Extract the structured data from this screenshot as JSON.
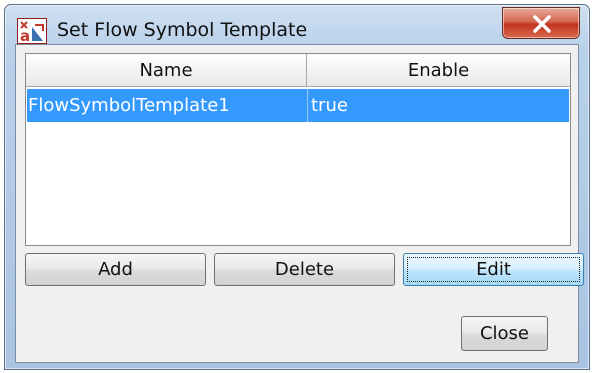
{
  "window": {
    "title": "Set Flow Symbol Template",
    "app_icon": "app-logo-icon",
    "close_icon": "close-icon",
    "colors": {
      "title_close_button": "#c94a32",
      "selection": "#3399ff"
    }
  },
  "table": {
    "columns": [
      "Name",
      "Enable"
    ],
    "rows": [
      {
        "name": "FlowSymbolTemplate1",
        "enable": "true",
        "selected": true
      }
    ]
  },
  "buttons": {
    "add": "Add",
    "delete": "Delete",
    "edit": "Edit",
    "close": "Close"
  }
}
